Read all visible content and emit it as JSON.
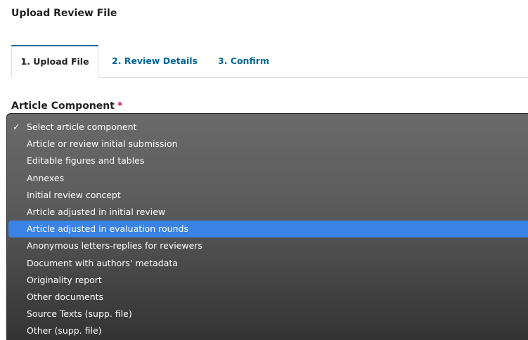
{
  "modal": {
    "title": "Upload Review File"
  },
  "tabs": [
    {
      "label": "1. Upload File",
      "active": true
    },
    {
      "label": "2. Review Details",
      "active": false
    },
    {
      "label": "3. Confirm",
      "active": false
    }
  ],
  "field": {
    "label": "Article Component",
    "required_mark": "*"
  },
  "dropdown": {
    "check_glyph": "✓",
    "options": [
      "Select article component",
      "Article or review initial submission",
      "Editable figures and tables",
      "Annexes",
      "Initial review concept",
      "Article adjusted in initial review",
      "Article adjusted in evaluation rounds",
      "Anonymous letters-replies for reviewers",
      "Document with authors' metadata",
      "Originality report",
      "Other documents",
      "Source Texts (supp. file)",
      "Other (supp. file)"
    ],
    "selected_index": 0,
    "highlighted_index": 6
  },
  "colors": {
    "accent": "#006798",
    "required": "#d00a6c",
    "highlight": "#3a82e6"
  }
}
